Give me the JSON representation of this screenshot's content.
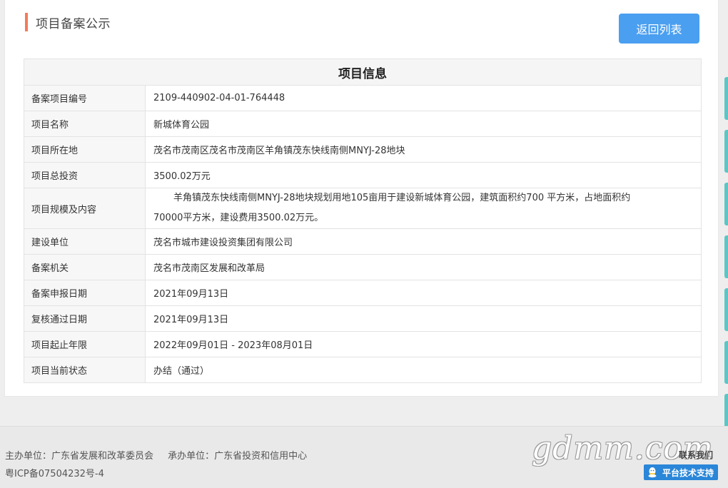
{
  "header": {
    "title": "项目备案公示",
    "back_button": "返回列表"
  },
  "table": {
    "title": "项目信息",
    "rows": [
      {
        "label": "备案项目编号",
        "value": "2109-440902-04-01-764448"
      },
      {
        "label": "项目名称",
        "value": "新城体育公园"
      },
      {
        "label": "项目所在地",
        "value": "茂名市茂南区茂名市茂南区羊角镇茂东快线南侧MNYJ-28地块"
      },
      {
        "label": "项目总投资",
        "value": "3500.02万元"
      },
      {
        "label": "项目规模及内容",
        "value_line1": "羊角镇茂东快线南侧MNYJ-28地块规划用地105亩用于建设新城体育公园，建筑面积约700 平方米，占地面积约",
        "value_line2": "70000平方米，建设费用3500.02万元。"
      },
      {
        "label": "建设单位",
        "value": "茂名市城市建设投资集团有限公司"
      },
      {
        "label": "备案机关",
        "value": "茂名市茂南区发展和改革局"
      },
      {
        "label": "备案申报日期",
        "value": "2021年09月13日"
      },
      {
        "label": "复核通过日期",
        "value": "2021年09月13日"
      },
      {
        "label": "项目起止年限",
        "value": "2022年09月01日 - 2023年08月01日"
      },
      {
        "label": "项目当前状态",
        "value": "办结（通过）"
      }
    ]
  },
  "footer": {
    "sponsor": "主办单位：广东省发展和改革委员会",
    "organizer": "承办单位：广东省投资和信用中心",
    "icp": "粤ICP备07504232号-4",
    "brand": "gdmm.com",
    "contact": "联系我们",
    "support": "平台技术支持",
    "support_icon": "qq-icon"
  },
  "colors": {
    "accent_bar": "#f47b5a",
    "button": "#4a9ff0",
    "support_button": "#2a86d8",
    "side_tab": "#5cc6c4"
  }
}
